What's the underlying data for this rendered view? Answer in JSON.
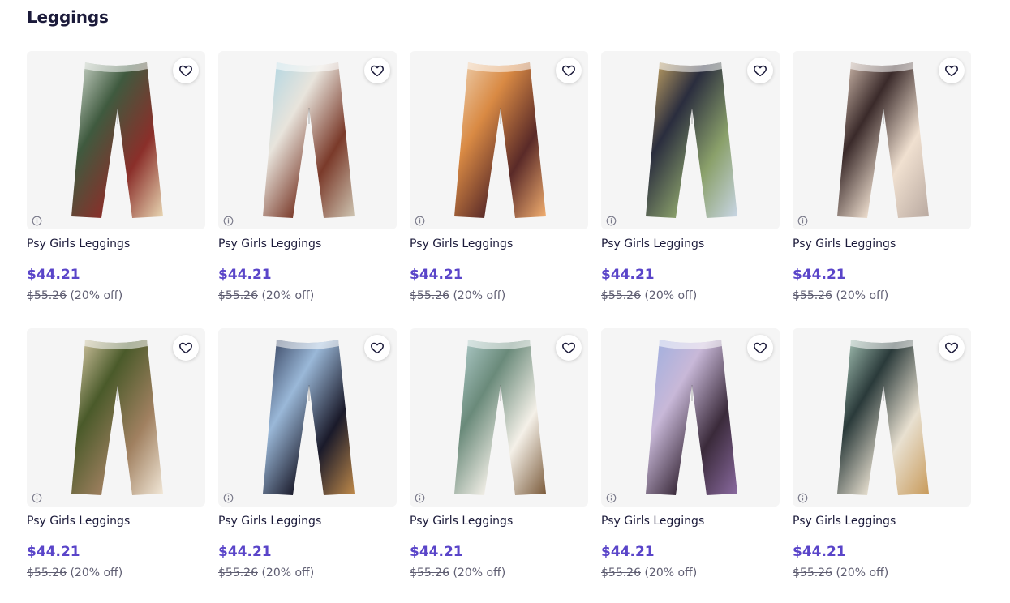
{
  "section": {
    "title": "Leggings"
  },
  "colors": {
    "accent_price": "#5a45c9",
    "text": "#1b1a3a",
    "muted": "#5f5e72",
    "thumb_bg": "#f5f5f5"
  },
  "icons": {
    "favorite": "heart-icon",
    "info": "info-icon"
  },
  "products": [
    {
      "title": "Psy Girls Leggings",
      "price": "$44.21",
      "original_price": "$55.26",
      "discount": "(20% off)",
      "palette": [
        "#dfe6dc",
        "#3f5a3f",
        "#8a2f2a",
        "#e9d8b4"
      ]
    },
    {
      "title": "Psy Girls Leggings",
      "price": "$44.21",
      "original_price": "$55.26",
      "discount": "(20% off)",
      "palette": [
        "#a9d4e3",
        "#e8e4dc",
        "#7a3a2a",
        "#cfc6b3"
      ]
    },
    {
      "title": "Psy Girls Leggings",
      "price": "$44.21",
      "original_price": "$55.26",
      "discount": "(20% off)",
      "palette": [
        "#f0d6b8",
        "#d98a44",
        "#5a2a28",
        "#f4b070"
      ]
    },
    {
      "title": "Psy Girls Leggings",
      "price": "$44.21",
      "original_price": "$55.26",
      "discount": "(20% off)",
      "palette": [
        "#d9b46a",
        "#2a2d3e",
        "#8aa06a",
        "#c9d6e6"
      ]
    },
    {
      "title": "Psy Girls Leggings",
      "price": "$44.21",
      "original_price": "$55.26",
      "discount": "(20% off)",
      "palette": [
        "#e6d0c0",
        "#3a2a2a",
        "#f0e0d0",
        "#b9a9a0"
      ]
    },
    {
      "title": "Psy Girls Leggings",
      "price": "$44.21",
      "original_price": "$55.26",
      "discount": "(20% off)",
      "palette": [
        "#e8d6b4",
        "#4a5a2a",
        "#a08060",
        "#f2e8d8"
      ]
    },
    {
      "title": "Psy Girls Leggings",
      "price": "$44.21",
      "original_price": "$55.26",
      "discount": "(20% off)",
      "palette": [
        "#2a3450",
        "#9ab8d8",
        "#1a1a2a",
        "#c08a4a"
      ]
    },
    {
      "title": "Psy Girls Leggings",
      "price": "$44.21",
      "original_price": "$55.26",
      "discount": "(20% off)",
      "palette": [
        "#b8d4d4",
        "#6a8a7a",
        "#f4f0e8",
        "#7a5a3a"
      ]
    },
    {
      "title": "Psy Girls Leggings",
      "price": "$44.21",
      "original_price": "$55.26",
      "discount": "(20% off)",
      "palette": [
        "#9aaee0",
        "#c8b8d8",
        "#3a2a3a",
        "#8a6aa0"
      ]
    },
    {
      "title": "Psy Girls Leggings",
      "price": "$44.21",
      "original_price": "$55.26",
      "discount": "(20% off)",
      "palette": [
        "#b8d8c8",
        "#2a3a3a",
        "#e8e0d0",
        "#c89a5a"
      ]
    }
  ]
}
